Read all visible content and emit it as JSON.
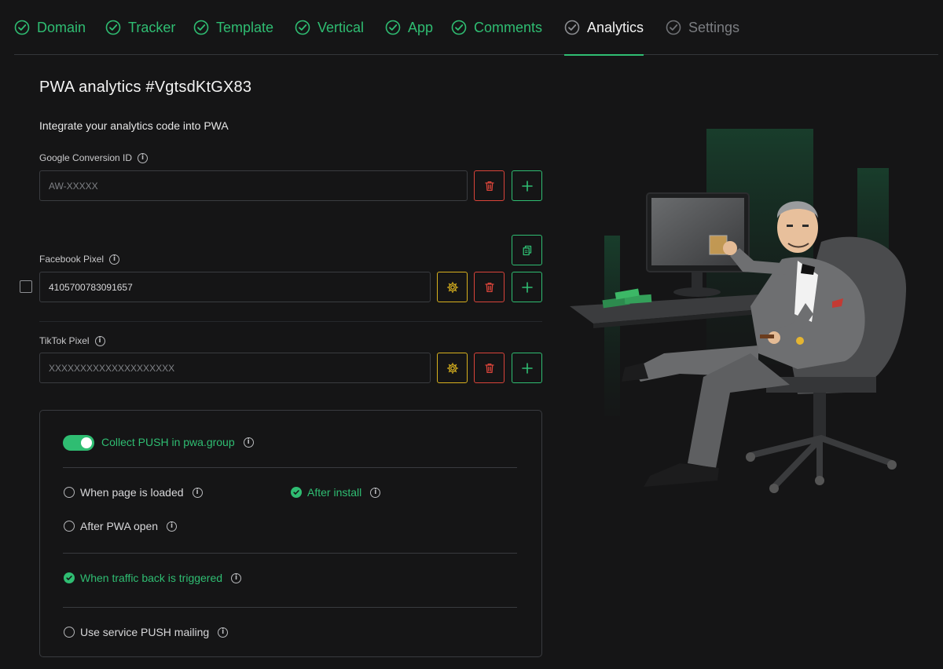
{
  "tabs": [
    {
      "label": "Domain",
      "state": "done"
    },
    {
      "label": "Tracker",
      "state": "done"
    },
    {
      "label": "Template",
      "state": "done"
    },
    {
      "label": "Vertical",
      "state": "done"
    },
    {
      "label": "App",
      "state": "done"
    },
    {
      "label": "Comments",
      "state": "done"
    },
    {
      "label": "Analytics",
      "state": "active"
    },
    {
      "label": "Settings",
      "state": "inactive"
    }
  ],
  "page": {
    "title": "PWA analytics #VgtsdKtGX83",
    "subtitle": "Integrate your analytics code into PWA"
  },
  "google": {
    "label": "Google Conversion ID",
    "placeholder": "AW-XXXXX",
    "value": ""
  },
  "facebook": {
    "label": "Facebook Pixel",
    "value": "4105700783091657",
    "checked": false
  },
  "tiktok": {
    "label": "TikTok Pixel",
    "placeholder": "XXXXXXXXXXXXXXXXXXXX",
    "value": ""
  },
  "push": {
    "collect_label": "Collect PUSH in pwa.group",
    "collect_enabled": true,
    "options": {
      "page_loaded": {
        "label": "When page is loaded",
        "selected": false
      },
      "after_install": {
        "label": "After install",
        "selected": true
      },
      "after_open": {
        "label": "After PWA open",
        "selected": false
      },
      "traffic_back": {
        "label": "When traffic back is triggered",
        "selected": true
      },
      "service_mailing": {
        "label": "Use service PUSH mailing",
        "selected": false
      }
    }
  },
  "icons": {
    "tab_check": "check-circle-icon",
    "delete": "trash-icon",
    "add": "plus-icon",
    "settings": "gear-icon",
    "copy": "copy-icon",
    "info": "info-icon"
  },
  "colors": {
    "accent_green": "#2fbd72",
    "danger_red": "#d9443a",
    "warning_yellow": "#d8b11e",
    "background": "#151516"
  }
}
